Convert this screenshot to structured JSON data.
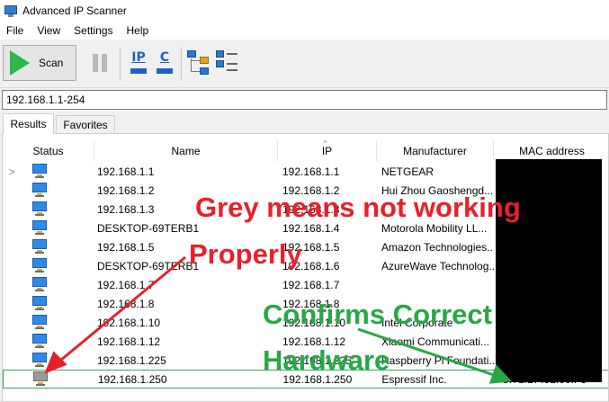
{
  "window": {
    "title": "Advanced IP Scanner"
  },
  "menu": [
    "File",
    "View",
    "Settings",
    "Help"
  ],
  "toolbar": {
    "scan_label": "Scan",
    "ip_label": "IP",
    "c_label": "C"
  },
  "range": {
    "value": "192.168.1.1-254"
  },
  "tabs": [
    "Results",
    "Favorites"
  ],
  "columns": [
    "Status",
    "Name",
    "IP",
    "Manufacturer",
    "MAC address"
  ],
  "rows": [
    {
      "expander": ">",
      "name": "192.168.1.1",
      "ip": "192.168.1.1",
      "manufacturer": "NETGEAR",
      "mac": ""
    },
    {
      "expander": "",
      "name": "192.168.1.2",
      "ip": "192.168.1.2",
      "manufacturer": "Hui Zhou Gaoshengd...",
      "mac": ""
    },
    {
      "expander": "",
      "name": "192.168.1.3",
      "ip": "192.168.1.3",
      "manufacturer": "",
      "mac": ""
    },
    {
      "expander": "",
      "name": "DESKTOP-69TERB1",
      "ip": "192.168.1.4",
      "manufacturer": "Motorola Mobility LL...",
      "mac": ""
    },
    {
      "expander": "",
      "name": "192.168.1.5",
      "ip": "192.168.1.5",
      "manufacturer": "Amazon Technologies...",
      "mac": ""
    },
    {
      "expander": "",
      "name": "DESKTOP-69TERB1",
      "ip": "192.168.1.6",
      "manufacturer": "AzureWave Technolog...",
      "mac": ""
    },
    {
      "expander": "",
      "name": "192.168.1.7",
      "ip": "192.168.1.7",
      "manufacturer": "",
      "mac": ""
    },
    {
      "expander": "",
      "name": "192.168.1.8",
      "ip": "192.168.1.8",
      "manufacturer": "",
      "mac": ""
    },
    {
      "expander": "",
      "name": "192.168.1.10",
      "ip": "192.168.1.10",
      "manufacturer": "Intel Corporate",
      "mac": ""
    },
    {
      "expander": "",
      "name": "192.168.1.12",
      "ip": "192.168.1.12",
      "manufacturer": "Xiaomi Communicati...",
      "mac": ""
    },
    {
      "expander": "",
      "name": "192.168.1.225",
      "ip": "192.168.1.225",
      "manufacturer": "Raspberry Pi Foundati...",
      "mac": ""
    },
    {
      "expander": "",
      "name": "192.168.1.250",
      "ip": "192.168.1.250",
      "manufacturer": "Espressif Inc.",
      "mac": "C:71:BF:32:00:F3"
    }
  ],
  "annotations": {
    "red_line1": "Grey means not working",
    "red_line2": "Properly",
    "green_line1": "Confirms Correct",
    "green_line2": "Hardware"
  },
  "colors": {
    "online_screen": "#2e8ae6",
    "offline_screen": "#9a9a9a",
    "annotation_red": "#e8202a",
    "annotation_green": "#27a845",
    "scan_green": "#2db84b"
  }
}
